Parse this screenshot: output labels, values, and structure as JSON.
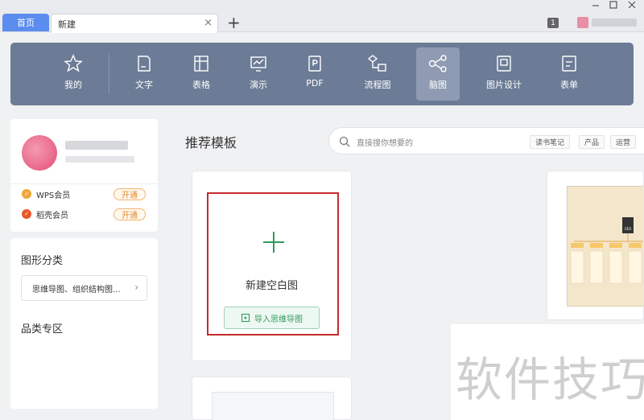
{
  "tabs": {
    "home_label": "首页",
    "new_label": "新建",
    "close_glyph": "×",
    "add_glyph": "+"
  },
  "titlebar": {
    "counter": "1"
  },
  "toolbar": {
    "items": [
      {
        "label": "我的",
        "icon": "star-icon"
      },
      {
        "label": "文字",
        "icon": "document-icon"
      },
      {
        "label": "表格",
        "icon": "table-icon"
      },
      {
        "label": "演示",
        "icon": "presentation-icon"
      },
      {
        "label": "PDF",
        "icon": "pdf-icon"
      },
      {
        "label": "流程图",
        "icon": "flowchart-icon"
      },
      {
        "label": "脑图",
        "icon": "mindmap-icon",
        "active": true
      },
      {
        "label": "图片设计",
        "icon": "image-design-icon"
      },
      {
        "label": "表单",
        "icon": "form-icon"
      }
    ]
  },
  "profile": {
    "members": [
      {
        "label": "WPS会员",
        "button": "开通",
        "color": "#f0a63a"
      },
      {
        "label": "稻壳会员",
        "button": "开通",
        "color": "#e8572a"
      }
    ]
  },
  "categories": {
    "title": "图形分类",
    "select_value": "思维导图、组织结构图...",
    "zone_title": "品类专区"
  },
  "main": {
    "section_title": "推荐模板",
    "search_placeholder": "直接搜你想要的",
    "tags": [
      "读书笔记",
      "产品",
      "运营"
    ],
    "new_blank_label": "新建空白图",
    "import_label": "导入思维导图"
  },
  "template_preview": {
    "node_label": "CEO"
  },
  "watermark": {
    "text": "软件技巧"
  },
  "colors": {
    "toolbar_bg": "#6c7c96",
    "accent_green": "#2f9a5f",
    "highlight_red": "#c62b2b",
    "tab_blue": "#5b8def"
  }
}
